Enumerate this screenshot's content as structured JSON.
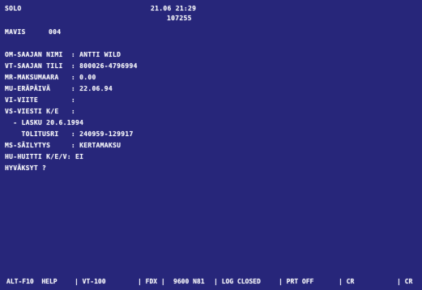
{
  "header": {
    "mode": "SOLO",
    "datetime": "21.06 21:29",
    "counter": "107255",
    "page_label": "MAVIS",
    "page_number": "004"
  },
  "form": {
    "lines": [
      "OM-SAAJAN NIMI  : ANTTI WILD",
      "VT-SAAJAN TILI  : 800026-4796994",
      "MR-MAKSUMAARA   : 0.00",
      "MU-ERÄPÄIVÄ     : 22.06.94",
      "VI-VIITE        :",
      "VS-VIESTI K/E   :",
      "  - LASKU 20.6.1994",
      "    TOLITUSRI   : 240959-129917",
      "MS-SÄILYTYS     : KERTAMAKSU",
      "HU-HUITTI K/E/V: EI",
      "HYVÄKSYT ?"
    ]
  },
  "status_bar": {
    "items": [
      "ALT-F10  HELP",
      "| VT-100",
      "| FDX |",
      "9600 N81",
      "| LOG CLOSED",
      "| PRT OFF",
      "| CR",
      "| CR"
    ]
  },
  "colors": {
    "screen_background": "#27267a",
    "text": "#f2f2f8"
  }
}
